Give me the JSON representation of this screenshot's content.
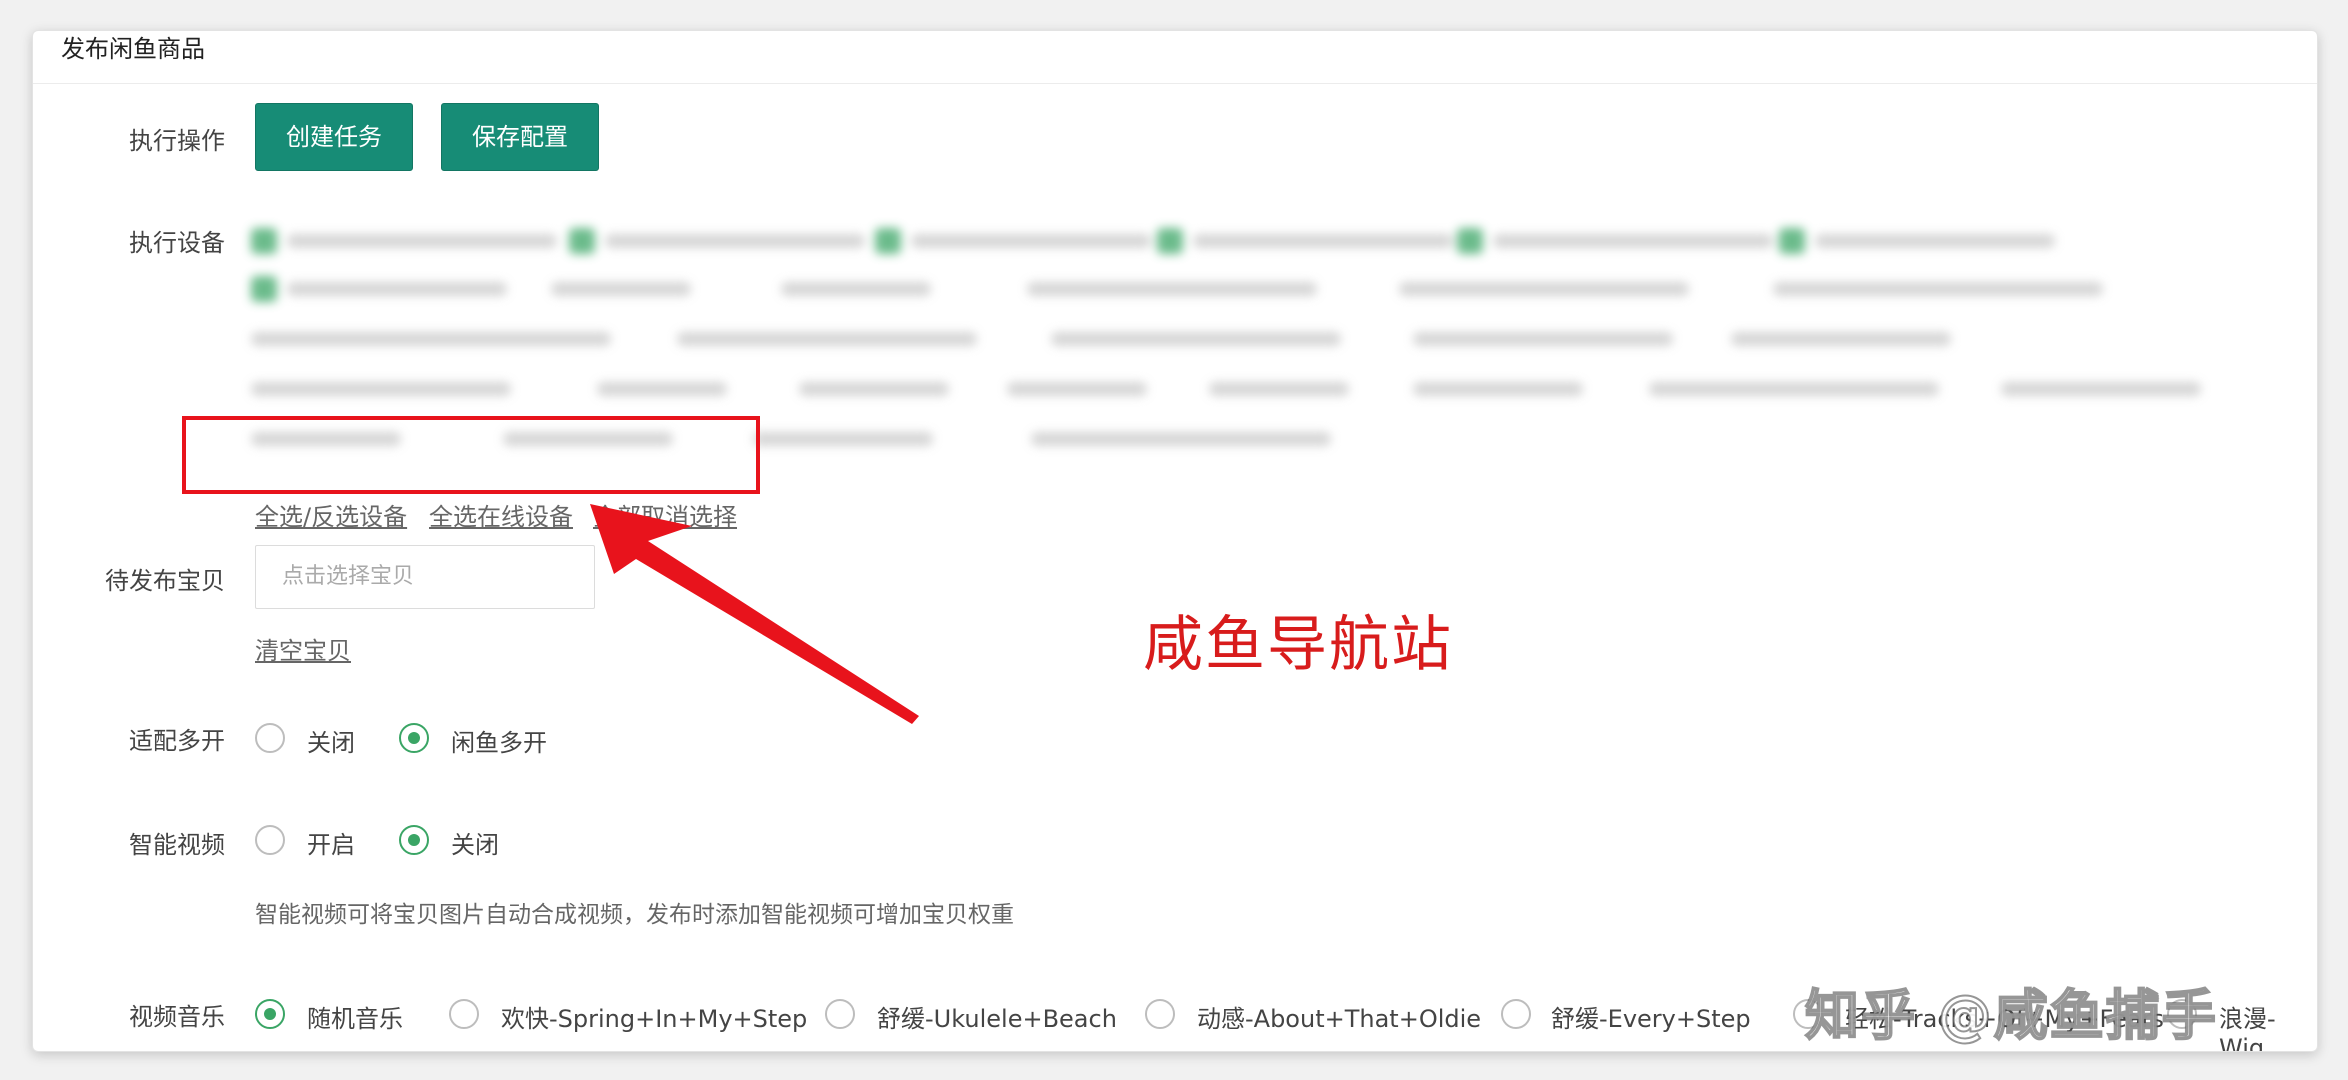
{
  "panel": {
    "title": "发布闲鱼商品"
  },
  "actions": {
    "label": "执行操作",
    "create_task": "创建任务",
    "save_config": "保存配置"
  },
  "devices": {
    "label": "执行设备",
    "select_all": "全选/反选设备",
    "select_online": "全选在线设备",
    "deselect_all": "全部取消选择"
  },
  "items": {
    "label": "待发布宝贝",
    "placeholder": "点击选择宝贝",
    "clear": "清空宝贝"
  },
  "multi_open": {
    "label": "适配多开",
    "options": [
      "关闭",
      "闲鱼多开"
    ],
    "selected": "闲鱼多开"
  },
  "smart_video": {
    "label": "智能视频",
    "options": [
      "开启",
      "关闭"
    ],
    "selected": "关闭",
    "note": "智能视频可将宝贝图片自动合成视频，发布时添加智能视频可增加宝贝权重"
  },
  "video_music": {
    "label": "视频音乐",
    "options": [
      "随机音乐",
      "欢快-Spring+In+My+Step",
      "舒缓-Ukulele+Beach",
      "动感-About+That+Oldie",
      "舒缓-Every+Step",
      "轻松-Tracks+Of+My+Fears",
      "浪漫-Wig"
    ],
    "selected": "随机音乐"
  },
  "watermark": {
    "text": "咸鱼导航站",
    "zhihu": "知乎 @咸鱼捕手"
  },
  "colors": {
    "primary": "#178c76",
    "accent_green": "#3aa565",
    "annotation_red": "#e8131c"
  }
}
